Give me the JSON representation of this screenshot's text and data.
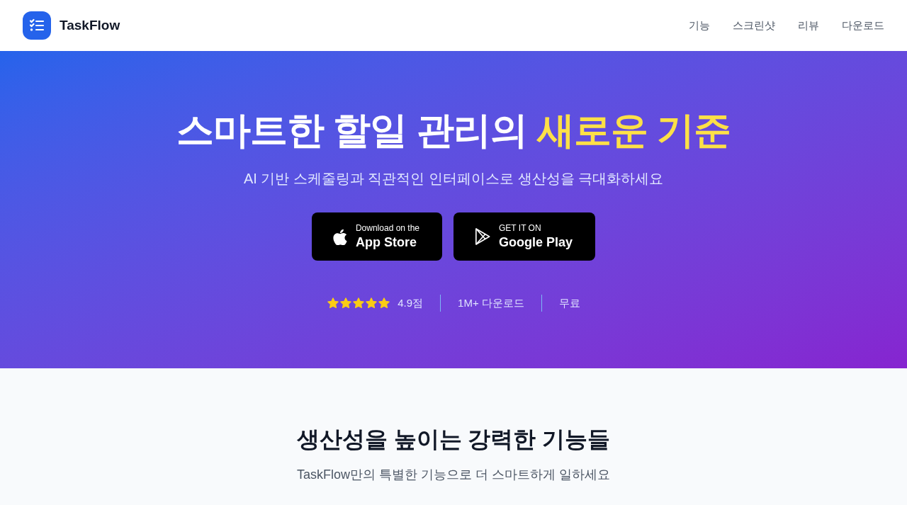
{
  "header": {
    "brand": "TaskFlow",
    "nav": [
      "기능",
      "스크린샷",
      "리뷰",
      "다운로드"
    ]
  },
  "hero": {
    "title": "스마트한 할일 관리의",
    "title_highlight": "새로운 기준",
    "subtitle": "AI 기반 스케줄링과 직관적인 인터페이스로 생산성을 극대화하세요",
    "store_buttons": [
      {
        "kind": "apple",
        "caption": "Download on the",
        "store": "App Store"
      },
      {
        "kind": "play",
        "caption": "GET IT ON",
        "store": "Google Play"
      }
    ],
    "stats": [
      {
        "kind": "rating",
        "stars": 5,
        "text": "4.9점"
      },
      {
        "kind": "text",
        "text": "1M+ 다운로드"
      },
      {
        "kind": "text",
        "text": "무료"
      }
    ]
  },
  "features": {
    "title": "생산성을 높이는 강력한 기능들",
    "subtitle": "TaskFlow만의 특별한 기능으로 더 스마트하게 일하세요"
  }
}
